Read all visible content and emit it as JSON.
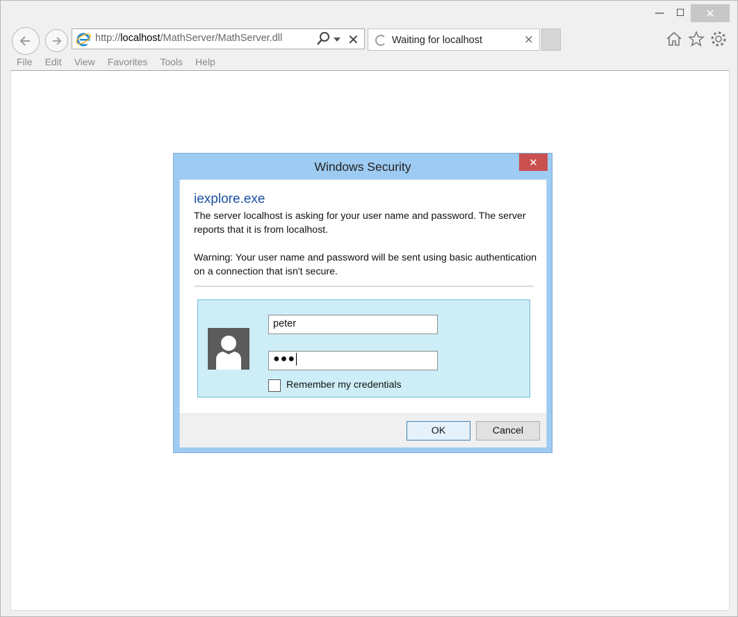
{
  "browser": {
    "address": {
      "prefix": "http://",
      "host": "localhost",
      "path": "/MathServer/MathServer.dll"
    },
    "tab": {
      "title": "Waiting for localhost"
    },
    "menu": [
      "File",
      "Edit",
      "View",
      "Favorites",
      "Tools",
      "Help"
    ],
    "icons": {
      "back": "back-arrow-icon",
      "forward": "forward-arrow-icon",
      "search": "search-icon",
      "stop": "stop-icon",
      "home": "home-icon",
      "favorites": "star-icon",
      "settings": "gear-icon"
    },
    "caption": {
      "minimize": "—",
      "maximize": "☐",
      "close": "✕"
    },
    "stop_glyph": "✕",
    "tab_close_glyph": "×"
  },
  "dialog": {
    "title": "Windows Security",
    "close_glyph": "✕",
    "app_name": "iexplore.exe",
    "message": "The server localhost is asking for your user name and password. The server reports that it is from localhost.",
    "warning": "Warning: Your user name and password will be sent using basic authentication on a connection that isn't secure.",
    "username_value": "peter",
    "password_mask": "●●●",
    "remember_label": "Remember my credentials",
    "remember_checked": false,
    "ok_label": "OK",
    "cancel_label": "Cancel",
    "colors": {
      "title_bar": "#9dcbf2",
      "close": "#c9504e",
      "panel": "#cdeef7",
      "app_name": "#1b4fa3"
    }
  }
}
